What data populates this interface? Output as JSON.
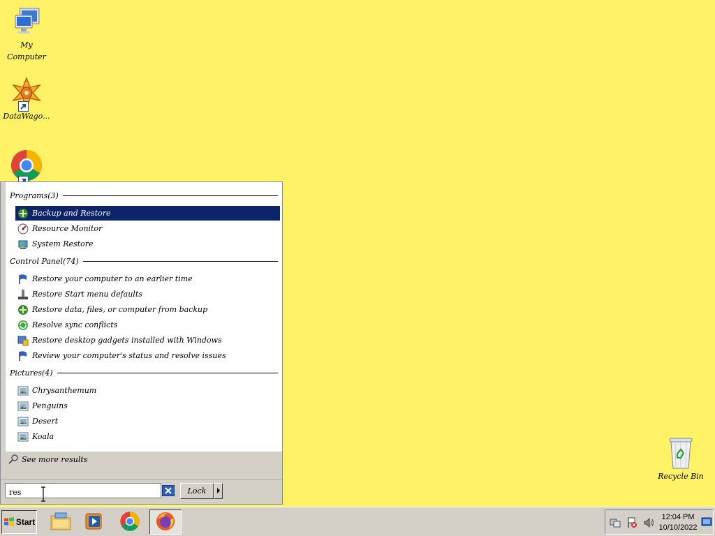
{
  "desktop": {
    "background_color": "#fff266",
    "icons": [
      {
        "label": "My Computer",
        "icon": "computer-icon"
      },
      {
        "label": "DataWago...",
        "icon": "datawago-icon"
      },
      {
        "label": "",
        "icon": "chrome-icon"
      },
      {
        "label": "Recycle Bin",
        "icon": "recycle-bin-icon"
      }
    ]
  },
  "start_menu": {
    "groups": [
      {
        "title": "Programs",
        "count": "(3)",
        "items": [
          {
            "label": "Backup and Restore",
            "icon": "backup-restore-icon",
            "selected": true
          },
          {
            "label": "Resource Monitor",
            "icon": "resource-monitor-icon"
          },
          {
            "label": "System Restore",
            "icon": "system-restore-icon"
          }
        ]
      },
      {
        "title": "Control Panel",
        "count": "(74)",
        "items": [
          {
            "label": "Restore your computer to an earlier time",
            "icon": "flag-icon"
          },
          {
            "label": "Restore Start menu defaults",
            "icon": "taskbar-settings-icon"
          },
          {
            "label": "Restore data, files, or computer from backup",
            "icon": "backup-restore-icon"
          },
          {
            "label": "Resolve sync conflicts",
            "icon": "sync-icon"
          },
          {
            "label": "Restore desktop gadgets installed with Windows",
            "icon": "gadgets-icon"
          },
          {
            "label": "Review your computer's status and resolve issues",
            "icon": "flag-icon"
          }
        ]
      },
      {
        "title": "Pictures",
        "count": "(4)",
        "items": [
          {
            "label": "Chrysanthemum",
            "icon": "picture-icon"
          },
          {
            "label": "Penguins",
            "icon": "picture-icon"
          },
          {
            "label": "Desert",
            "icon": "picture-icon"
          },
          {
            "label": "Koala",
            "icon": "picture-icon"
          }
        ]
      }
    ],
    "see_more": "See more results",
    "search_value": "res",
    "lock_label": "Lock"
  },
  "taskbar": {
    "start_label": "Start",
    "pinned": [
      "file-explorer-icon",
      "media-player-icon",
      "chrome-icon",
      "firefox-icon"
    ],
    "active_app": "firefox-icon",
    "time": "12:04 PM",
    "date": "10/10/2022"
  }
}
